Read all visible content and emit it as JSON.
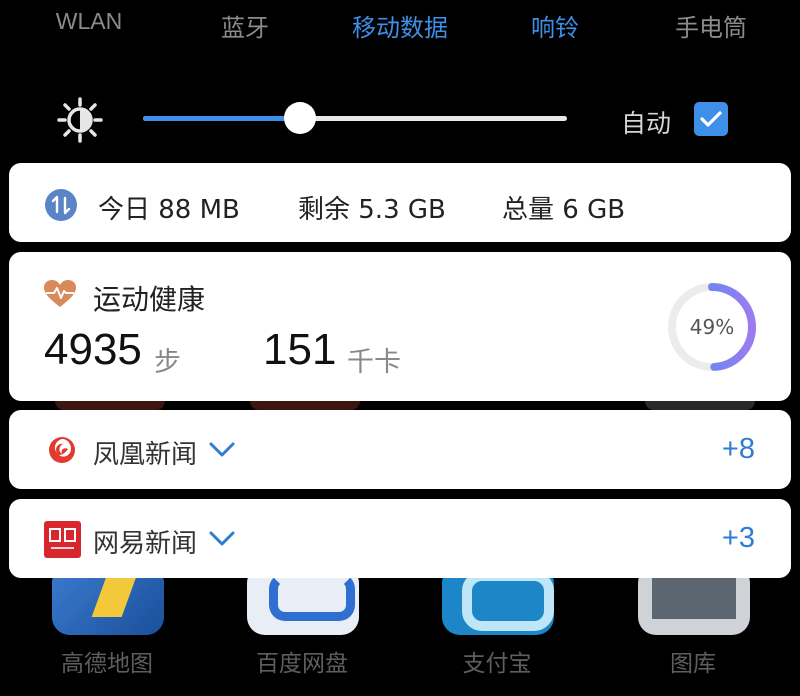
{
  "toggles": [
    {
      "label": "WLAN",
      "active": false
    },
    {
      "label": "蓝牙",
      "active": false
    },
    {
      "label": "移动数据",
      "active": true
    },
    {
      "label": "响铃",
      "active": true
    },
    {
      "label": "手电筒",
      "active": false
    }
  ],
  "brightness": {
    "level": 0.37,
    "auto_label": "自动",
    "auto_checked": true,
    "icon": "brightness-sun-icon"
  },
  "data_usage": {
    "today": "今日 88 MB",
    "remaining": "剩余 5.3 GB",
    "total": "总量 6 GB",
    "icon": "data-transfer-icon"
  },
  "health": {
    "title": "运动健康",
    "steps": "4935",
    "steps_unit": "步",
    "calories": "151",
    "calories_unit": "千卡",
    "progress_text": "49%",
    "progress": 0.49,
    "icon": "heart-rate-icon"
  },
  "news": [
    {
      "title": "凤凰新闻",
      "count": "+8",
      "icon": "ifeng-logo-icon"
    },
    {
      "title": "网易新闻",
      "count": "+3",
      "icon": "netease-logo-icon"
    }
  ],
  "background_apps": [
    {
      "label": "高德地图"
    },
    {
      "label": "百度网盘"
    },
    {
      "label": "支付宝"
    },
    {
      "label": "图库"
    }
  ],
  "colors": {
    "accent": "#3d8fe8",
    "card_bg": "#ffffff",
    "background": "#000000",
    "news_count": "#2f7dd3",
    "ring_start": "#4a8ef0",
    "ring_end": "#9b7cf0"
  }
}
